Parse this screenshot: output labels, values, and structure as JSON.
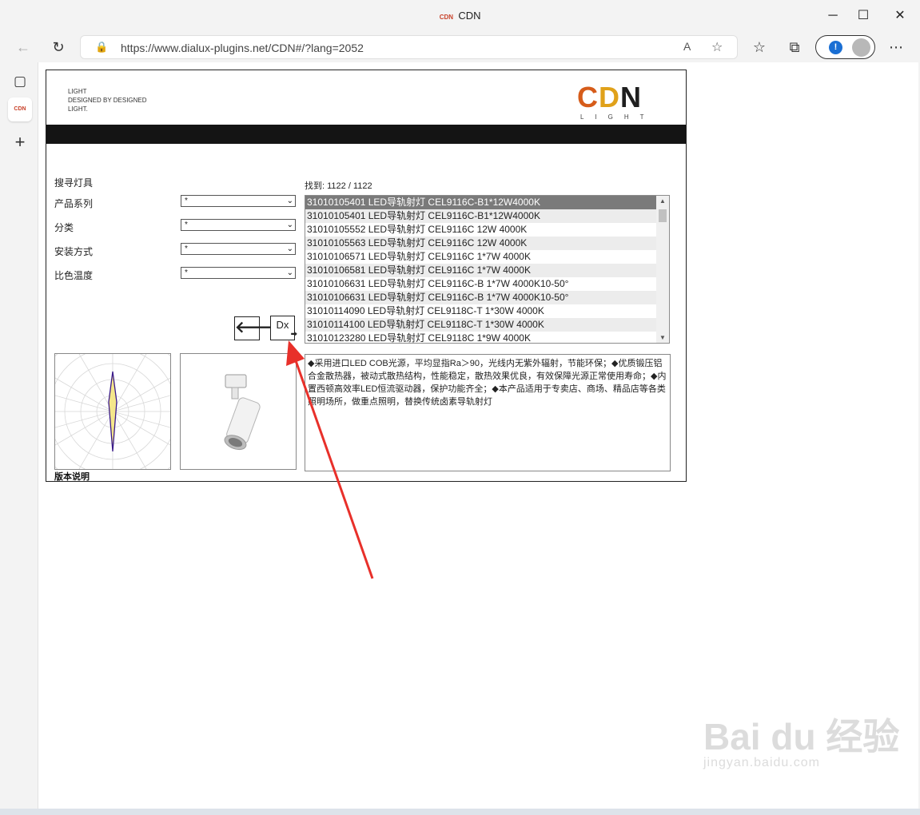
{
  "window": {
    "title": "CDN",
    "favicon_text": "CDN",
    "controls": {
      "minimize": "─",
      "maximize": "☐",
      "close": "✕"
    }
  },
  "toolbar": {
    "back_icon": "←",
    "refresh_icon": "↻",
    "url": "https://www.dialux-plugins.net/CDN#/?lang=2052",
    "lock_icon": "🔒",
    "read_aloud_icon": "A",
    "add_fav_icon": "☆",
    "favorites_icon": "☆",
    "collections_icon": "⧉",
    "profile_badge": "!",
    "more_icon": "⋯"
  },
  "sidetabs": {
    "tab_actions_icon": "▢",
    "tab_label": "CDN",
    "new_tab_icon": "+"
  },
  "page": {
    "tagline": [
      "LIGHT",
      "DESIGNED BY DESIGNED",
      "LIGHT."
    ],
    "brand": {
      "c": "C",
      "d": "D",
      "n": "N",
      "sub": "LIGHT"
    },
    "search_title": "搜寻灯具",
    "filters": [
      {
        "label": "产品系列",
        "value": "*"
      },
      {
        "label": "分类",
        "value": "*"
      },
      {
        "label": "安装方式",
        "value": "*"
      },
      {
        "label": "比色温度",
        "value": "*"
      }
    ],
    "back_button": "🡐",
    "dx_button": "Dx",
    "found": "找到: 1122 / 1122",
    "products": [
      "31010105401 LED导轨射灯 CEL9116C-B1*12W4000K",
      "31010105401 LED导轨射灯 CEL9116C-B1*12W4000K",
      "31010105552 LED导轨射灯 CEL9116C 12W 4000K",
      "31010105563 LED导轨射灯 CEL9116C 12W 4000K",
      "31010106571 LED导轨射灯 CEL9116C 1*7W 4000K",
      "31010106581 LED导轨射灯 CEL9116C 1*7W 4000K",
      "31010106631 LED导轨射灯 CEL9116C-B 1*7W 4000K10-50°",
      "31010106631 LED导轨射灯 CEL9116C-B 1*7W 4000K10-50°",
      "31010114090 LED导轨射灯 CEL9118C-T 1*30W 4000K",
      "31010114100 LED导轨射灯 CEL9118C-T 1*30W 4000K",
      "31010123280 LED导轨射灯 CEL9118C 1*9W 4000K"
    ],
    "description": "◆采用进口LED COB光源，平均显指Ra＞90，光线内无紫外辐射，节能环保；◆优质锻压铝合金散热器，被动式散热结构，性能稳定，散热效果优良，有效保障光源正常使用寿命；◆内置西顿高效率LED恒流驱动器，保护功能齐全；◆本产品适用于专卖店、商场、精品店等各类照明场所，做重点照明，替换传统卤素导轨射灯",
    "version_label": "版本说明"
  },
  "watermark": {
    "main": "Bai du 经验",
    "sub": "jingyan.baidu.com"
  },
  "colors": {
    "brand_c": "#d65c1a",
    "brand_d": "#e0a11a",
    "brand_n": "#1f1f1f",
    "annotation_arrow": "#e8302a",
    "selected_row": "#7a7a7a"
  }
}
